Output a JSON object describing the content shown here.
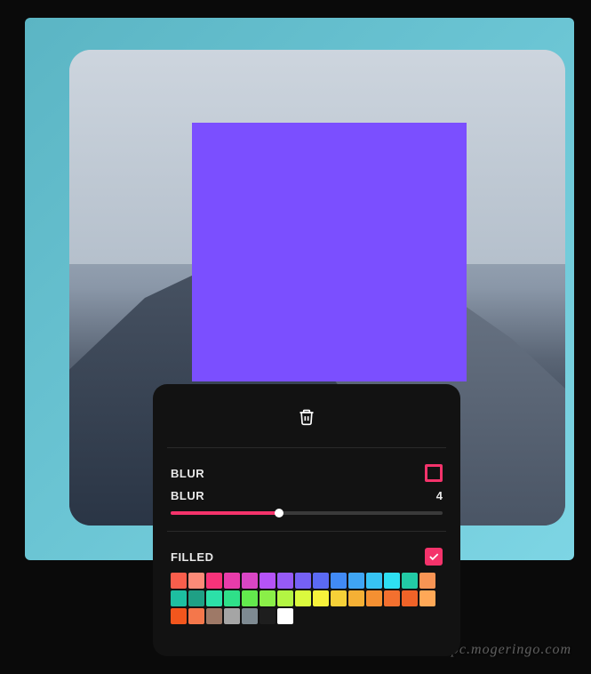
{
  "editor": {
    "selection": {
      "color": "#7B4FFF"
    }
  },
  "popover": {
    "delete_icon": "trash-icon",
    "blur_section": {
      "label_toggle": "BLUR",
      "label_slider": "BLUR",
      "value": "4",
      "slider_percent": 40
    },
    "filled_section": {
      "label": "FILLED",
      "checked": true
    },
    "colors": [
      "#F95E4C",
      "#FC8A78",
      "#F6337A",
      "#E83CAA",
      "#D946C5",
      "#B553F8",
      "#965AF6",
      "#7561F5",
      "#5B6AF3",
      "#418AF5",
      "#3FA5F4",
      "#37C3F3",
      "#2EDFF2",
      "#22CAA5",
      "#F89454",
      "#1DBFA0",
      "#1FA085",
      "#2CE0A8",
      "#2FE089",
      "#63E94D",
      "#8AEF48",
      "#B3F543",
      "#DBFA3E",
      "#F7F13B",
      "#F6D138",
      "#F5B035",
      "#F49032",
      "#F3702F",
      "#F06328",
      "#FFA857",
      "#F2561D",
      "#F4774B",
      "#9E7967",
      "#A5A5A5",
      "#7E8A92",
      "#1E1E1E",
      "#FFFFFF"
    ]
  },
  "watermark": "pc.mogeringo.com"
}
